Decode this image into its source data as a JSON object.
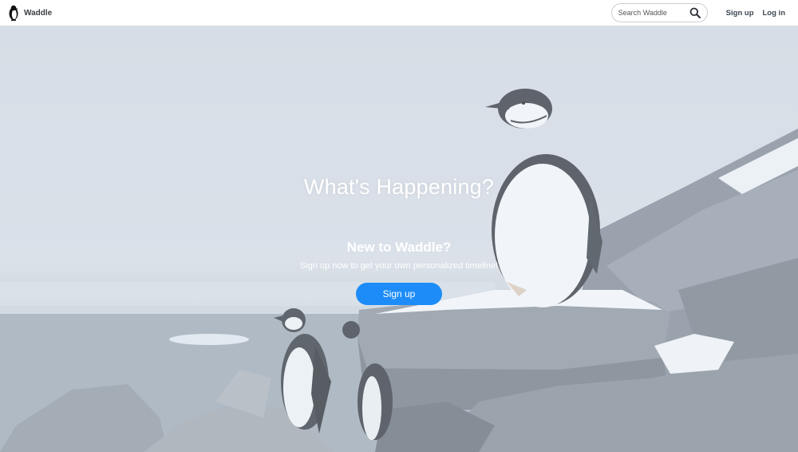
{
  "header": {
    "brand_name": "Waddle",
    "search_placeholder": "Search Waddle",
    "signup_label": "Sign up",
    "login_label": "Log in"
  },
  "hero": {
    "headline": "What's Happening?",
    "subhead": "New to Waddle?",
    "tagline": "Sign up now to get your own personalized timeline!",
    "cta_label": "Sign up"
  },
  "colors": {
    "accent": "#1d8cf8",
    "header_bg": "#ffffff",
    "brand_text": "#3a3f44"
  },
  "icons": {
    "brand": "penguin-icon",
    "search": "search-icon"
  }
}
